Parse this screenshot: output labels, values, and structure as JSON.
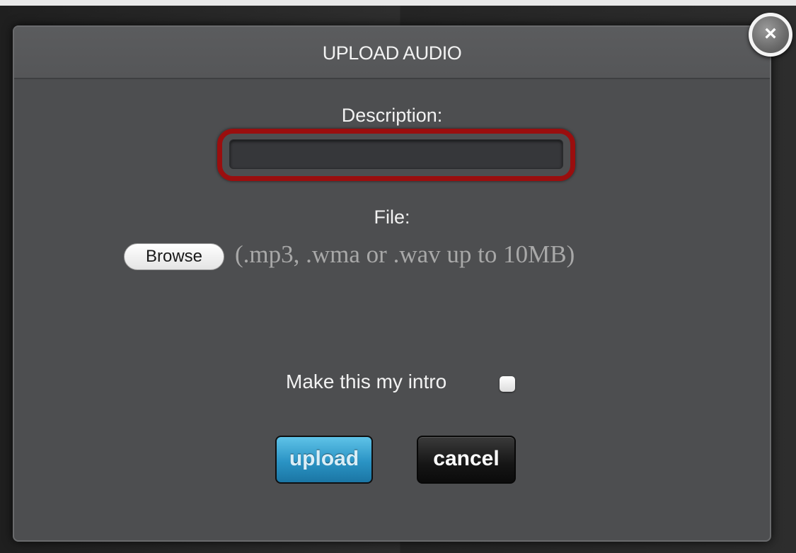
{
  "dialog": {
    "title": "UPLOAD AUDIO",
    "close_label": "×",
    "description": {
      "label": "Description:",
      "value": ""
    },
    "file": {
      "label": "File:",
      "browse_label": "Browse",
      "hint": "(.mp3, .wma or .wav up to 10MB)"
    },
    "intro": {
      "label": "Make this my intro",
      "checked": false
    },
    "buttons": {
      "upload_label": "upload",
      "cancel_label": "cancel"
    }
  },
  "colors": {
    "dialog_bg": "#4d4e50",
    "highlight_ring": "#9a0e0e",
    "upload_accent": "#2a93c4",
    "cancel_bg": "#151515"
  },
  "icons": {
    "close": "close-icon"
  }
}
